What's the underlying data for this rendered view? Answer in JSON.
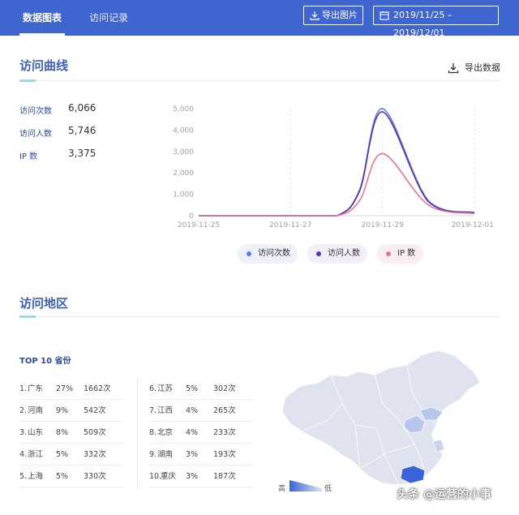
{
  "header": {
    "tabs": [
      {
        "label": "数据图表"
      },
      {
        "label": "访问记录"
      }
    ],
    "export_image_label": "导出图片",
    "date_range": "2019/11/25 – 2019/12/01"
  },
  "visit_curve": {
    "title": "访问曲线",
    "export_label": "导出数据",
    "stats": [
      {
        "label": "访问次数",
        "value": "6,066"
      },
      {
        "label": "访问人数",
        "value": "5,746"
      },
      {
        "label": "IP 数",
        "value": "3,375"
      }
    ]
  },
  "chart_data": {
    "type": "line",
    "x": [
      "2019-11-25",
      "2019-11-26",
      "2019-11-27",
      "2019-11-28",
      "2019-11-28 12h",
      "2019-11-29",
      "2019-11-30",
      "2019-12-01"
    ],
    "x_tick_labels": [
      "2019-11-25",
      "2019-11-27",
      "2019-11-29",
      "2019-12-01"
    ],
    "y_tick_labels": [
      "0",
      "1,000",
      "2,000",
      "3,000",
      "4,000",
      "5,000"
    ],
    "ylim": [
      0,
      5000
    ],
    "grid": "vertical dashed",
    "legend_position": "bottom",
    "series": [
      {
        "name": "访问次数",
        "color": "#5b7fe0",
        "values": [
          0,
          0,
          0,
          0,
          1200,
          5000,
          700,
          150
        ]
      },
      {
        "name": "访问人数",
        "color": "#5a35a8",
        "values": [
          0,
          0,
          0,
          0,
          1150,
          4850,
          650,
          130
        ]
      },
      {
        "name": "IP 数",
        "color": "#e0779a",
        "values": [
          0,
          0,
          0,
          0,
          700,
          2900,
          500,
          100
        ]
      }
    ]
  },
  "region": {
    "title": "访问地区",
    "top10_title": "TOP 10 省份",
    "rows": [
      {
        "rank": "1.",
        "name": "广东",
        "pct": "27%",
        "count": "1662次"
      },
      {
        "rank": "2.",
        "name": "河南",
        "pct": "9%",
        "count": "542次"
      },
      {
        "rank": "3.",
        "name": "山东",
        "pct": "8%",
        "count": "509次"
      },
      {
        "rank": "4.",
        "name": "浙江",
        "pct": "5%",
        "count": "332次"
      },
      {
        "rank": "5.",
        "name": "上海",
        "pct": "5%",
        "count": "330次"
      },
      {
        "rank": "6.",
        "name": "江苏",
        "pct": "5%",
        "count": "302次"
      },
      {
        "rank": "7.",
        "name": "江西",
        "pct": "4%",
        "count": "265次"
      },
      {
        "rank": "8.",
        "name": "北京",
        "pct": "4%",
        "count": "233次"
      },
      {
        "rank": "9.",
        "name": "湖南",
        "pct": "3%",
        "count": "193次"
      },
      {
        "rank": "10.",
        "name": "重庆",
        "pct": "3%",
        "count": "187次"
      }
    ],
    "scale_high": "高",
    "scale_low": "低"
  },
  "watermark": "头条 @运营的小事",
  "colors": {
    "brand": "#3f65d1",
    "accent": "#9ed7ea",
    "map_base": "#dfe2ef",
    "map_high": "#3a63d8"
  }
}
